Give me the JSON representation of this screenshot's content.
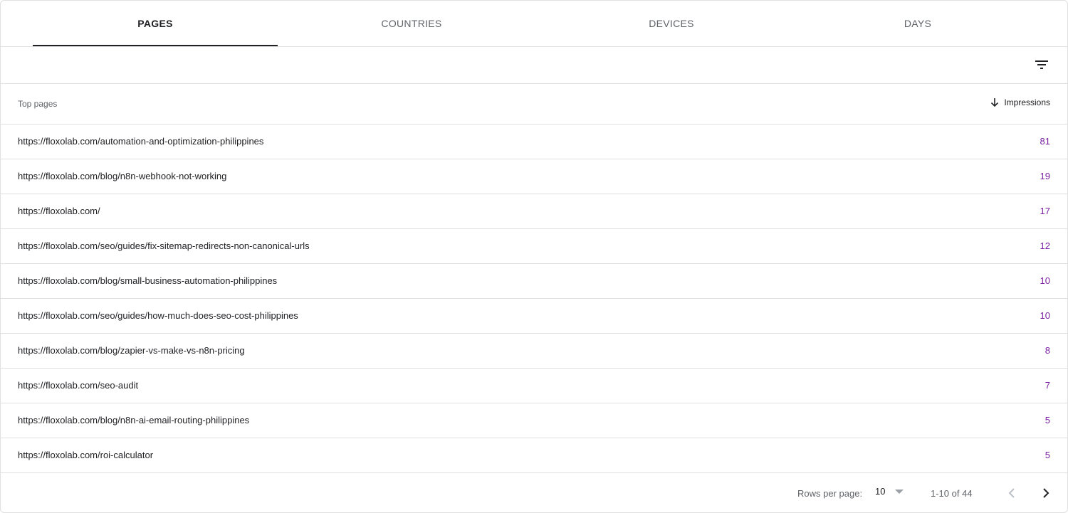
{
  "tabs": [
    {
      "label": "PAGES",
      "active": true
    },
    {
      "label": "COUNTRIES",
      "active": false
    },
    {
      "label": "DEVICES",
      "active": false
    },
    {
      "label": "DAYS",
      "active": false
    }
  ],
  "toolbar": {
    "filter_icon": "filter-list-icon"
  },
  "table": {
    "col_page": "Top pages",
    "col_impressions": "Impressions",
    "sort_icon": "arrow-down-icon",
    "value_color": "#7b1fa2",
    "rows": [
      {
        "url": "https://floxolab.com/automation-and-optimization-philippines",
        "impressions": "81"
      },
      {
        "url": "https://floxolab.com/blog/n8n-webhook-not-working",
        "impressions": "19"
      },
      {
        "url": "https://floxolab.com/",
        "impressions": "17"
      },
      {
        "url": "https://floxolab.com/seo/guides/fix-sitemap-redirects-non-canonical-urls",
        "impressions": "12"
      },
      {
        "url": "https://floxolab.com/blog/small-business-automation-philippines",
        "impressions": "10"
      },
      {
        "url": "https://floxolab.com/seo/guides/how-much-does-seo-cost-philippines",
        "impressions": "10"
      },
      {
        "url": "https://floxolab.com/blog/zapier-vs-make-vs-n8n-pricing",
        "impressions": "8"
      },
      {
        "url": "https://floxolab.com/seo-audit",
        "impressions": "7"
      },
      {
        "url": "https://floxolab.com/blog/n8n-ai-email-routing-philippines",
        "impressions": "5"
      },
      {
        "url": "https://floxolab.com/roi-calculator",
        "impressions": "5"
      }
    ]
  },
  "footer": {
    "rows_per_page_label": "Rows per page:",
    "rows_per_page_value": "10",
    "range": "1-10 of 44"
  }
}
